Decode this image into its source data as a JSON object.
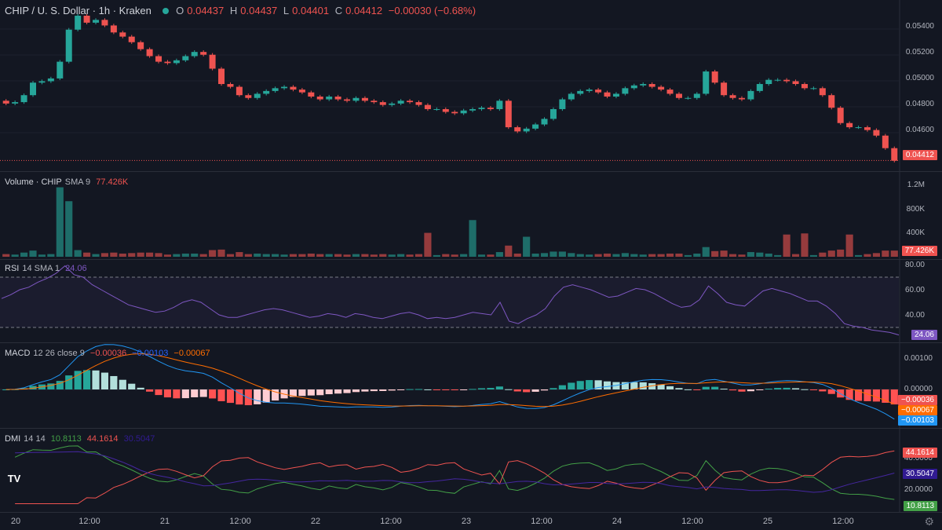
{
  "header": {
    "title": "CHIP / U. S. Dollar · 1h · Kraken",
    "o_label": "O",
    "o_value": "0.04437",
    "h_label": "H",
    "h_value": "0.04437",
    "l_label": "L",
    "l_value": "0.04401",
    "c_label": "C",
    "c_value": "0.04412",
    "change": "−0.00030 (−0.68%)"
  },
  "price_axis": {
    "ticks": [
      "0.05400",
      "0.05200",
      "0.05000",
      "0.04800",
      "0.04600"
    ],
    "last": "0.04412"
  },
  "volume": {
    "title": "Volume · CHIP",
    "sma": "SMA 9",
    "value": "77.426K",
    "ticks": [
      "1.2M",
      "800K",
      "400K"
    ],
    "last": "77.426K"
  },
  "rsi": {
    "title": "RSI",
    "params": "14 SMA 1",
    "value": "24.06",
    "ticks": [
      "80.00",
      "60.00",
      "40.00"
    ],
    "last": "24.06"
  },
  "macd": {
    "title": "MACD",
    "params": "12 26 close 9",
    "hist": "−0.00036",
    "macd": "−0.00103",
    "signal": "−0.00067",
    "ticks": [
      "0.00100",
      "0.00000"
    ],
    "last_hist": "−0.00036",
    "last_signal": "−0.00067",
    "last_macd": "−0.00103"
  },
  "dmi": {
    "title": "DMI",
    "params": "14 14",
    "plus_di": "10.8113",
    "minus_di": "44.1614",
    "adx": "30.5047",
    "ticks": [
      "40.0000",
      "20.0000"
    ],
    "last_minus": "44.1614",
    "last_adx": "30.5047",
    "last_plus": "10.8113"
  },
  "x_axis": {
    "labels": [
      "20",
      "12:00",
      "21",
      "12:00",
      "22",
      "12:00",
      "23",
      "12:00",
      "24",
      "12:00",
      "25",
      "12:00"
    ]
  },
  "colors": {
    "up": "#26a69a",
    "down": "#ef5350",
    "rsi": "#7e57c2",
    "macd": "#2962ff",
    "signal": "#ff6d00",
    "adx": "#311b92"
  },
  "icons": {
    "logo": "tradingview-logo",
    "settings": "gear-icon"
  },
  "chart_data": [
    {
      "type": "candlestick",
      "title": "CHIP / U. S. Dollar · 1h · Kraken",
      "close_series": [
        0.0482,
        0.0483,
        0.0488,
        0.0497,
        0.0498,
        0.05,
        0.0512,
        0.0535,
        0.0545,
        0.054,
        0.0542,
        0.0538,
        0.0533,
        0.053,
        0.0526,
        0.0521,
        0.0516,
        0.0512,
        0.0511,
        0.0513,
        0.0516,
        0.0519,
        0.0517,
        0.0507,
        0.0496,
        0.0494,
        0.0488,
        0.0486,
        0.0489,
        0.0491,
        0.0493,
        0.0494,
        0.0492,
        0.049,
        0.0487,
        0.0485,
        0.0487,
        0.0485,
        0.0484,
        0.0486,
        0.0484,
        0.0483,
        0.0481,
        0.0482,
        0.0484,
        0.0483,
        0.0481,
        0.0478,
        0.0478,
        0.0476,
        0.0475,
        0.0477,
        0.0478,
        0.0479,
        0.0478,
        0.0484,
        0.0465,
        0.0462,
        0.0464,
        0.0467,
        0.0471,
        0.0478,
        0.0485,
        0.0489,
        0.0491,
        0.0492,
        0.049,
        0.0487,
        0.0489,
        0.0493,
        0.0495,
        0.0496,
        0.0494,
        0.0492,
        0.0489,
        0.0486,
        0.0486,
        0.0489,
        0.0505,
        0.0497,
        0.0488,
        0.0486,
        0.0485,
        0.0491,
        0.0496,
        0.0499,
        0.0499,
        0.0498,
        0.0496,
        0.0493,
        0.0493,
        0.0488,
        0.0479,
        0.0468,
        0.0465,
        0.0465,
        0.0463,
        0.0459,
        0.045,
        0.0441
      ],
      "ylim": [
        0.0438,
        0.0545
      ],
      "ticks": [
        0.054,
        0.052,
        0.05,
        0.048,
        0.046
      ],
      "last_close": 0.04412,
      "x_labels": [
        "20",
        "12:00",
        "21",
        "12:00",
        "22",
        "12:00",
        "23",
        "12:00",
        "24",
        "12:00",
        "25",
        "12:00"
      ]
    },
    {
      "type": "bar",
      "title": "Volume · CHIP",
      "ylim": [
        0,
        1300000
      ],
      "ticks": [
        1200000,
        800000,
        400000
      ],
      "last": 77426,
      "spikes": [
        {
          "at": 0.065,
          "value": 1250000
        },
        {
          "at": 0.07,
          "value": 1000000
        },
        {
          "at": 0.47,
          "value": 430000
        },
        {
          "at": 0.52,
          "value": 660000
        },
        {
          "at": 0.58,
          "value": 360000
        },
        {
          "at": 0.87,
          "value": 400000
        },
        {
          "at": 0.89,
          "value": 420000
        },
        {
          "at": 0.94,
          "value": 400000
        }
      ]
    },
    {
      "type": "line",
      "title": "RSI",
      "ylim": [
        20,
        80
      ],
      "bands": [
        30,
        70
      ],
      "last": 24.06,
      "values": [
        53,
        56,
        60,
        62,
        66,
        69,
        73,
        79,
        72,
        70,
        64,
        60,
        56,
        52,
        48,
        46,
        44,
        42,
        43,
        46,
        50,
        52,
        50,
        45,
        40,
        38,
        38,
        40,
        42,
        44,
        45,
        44,
        42,
        40,
        38,
        39,
        41,
        40,
        38,
        41,
        40,
        38,
        37,
        39,
        41,
        42,
        40,
        37,
        38,
        37,
        38,
        40,
        42,
        41,
        40,
        50,
        35,
        33,
        37,
        40,
        45,
        55,
        62,
        64,
        62,
        60,
        57,
        54,
        55,
        58,
        61,
        60,
        57,
        53,
        49,
        46,
        47,
        52,
        63,
        57,
        50,
        48,
        47,
        53,
        59,
        61,
        59,
        57,
        54,
        51,
        51,
        47,
        41,
        33,
        31,
        30,
        28,
        27,
        26,
        24
      ]
    },
    {
      "type": "line",
      "title": "MACD",
      "ylim": [
        -0.0012,
        0.0012
      ],
      "ticks": [
        0.001,
        0
      ],
      "last": {
        "hist": -0.00036,
        "macd": -0.00103,
        "signal": -0.00067
      }
    },
    {
      "type": "line",
      "title": "DMI",
      "ylim": [
        0,
        55
      ],
      "ticks": [
        40,
        20
      ],
      "last": {
        "minus_di": 44.1614,
        "adx": 30.5047,
        "plus_di": 10.8113
      }
    }
  ]
}
